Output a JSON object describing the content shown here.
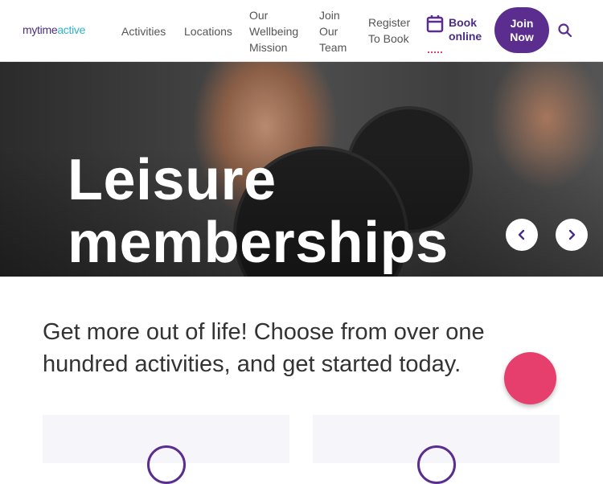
{
  "brand": {
    "logo_part1": "mytime",
    "logo_part2": "active"
  },
  "nav": {
    "activities": "Activities",
    "locations": "Locations",
    "wellbeing_line1": "Our",
    "wellbeing_line2": "Wellbeing",
    "wellbeing_line3": "Mission",
    "team_line1": "Join",
    "team_line2": "Our",
    "team_line3": "Team",
    "register_line1": "Register",
    "register_line2": "To Book",
    "book_line1": "Book",
    "book_line2": "online",
    "join_line1": "Join",
    "join_line2": "Now"
  },
  "hero": {
    "title_line1": "Leisure",
    "title_line2": "memberships"
  },
  "intro": {
    "text": "Get more out of life! Choose from over one hundred activities, and get started today."
  },
  "colors": {
    "brand_purple": "#5b2d8e",
    "brand_teal": "#2fb2c9",
    "accent_pink": "#e63e6d"
  },
  "icons": [
    "calendar-icon",
    "search-icon",
    "chevron-left-icon",
    "chevron-right-icon"
  ]
}
